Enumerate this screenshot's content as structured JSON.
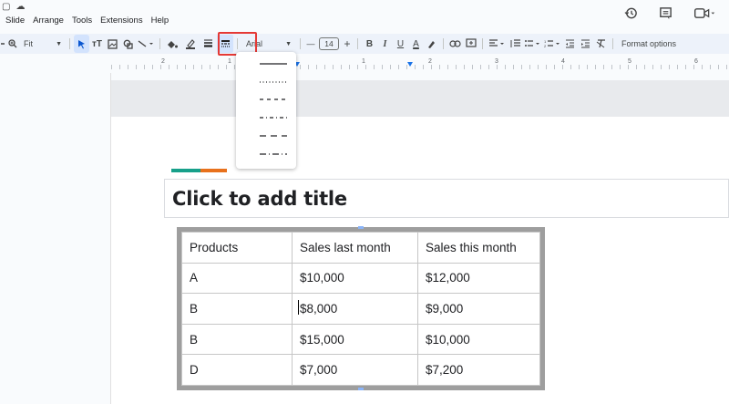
{
  "menu": [
    "Slide",
    "Arrange",
    "Tools",
    "Extensions",
    "Help"
  ],
  "toolbar": {
    "zoom": "Fit",
    "font": "Arial",
    "font_size": "14",
    "format_options": "Format options"
  },
  "ruler_numbers": [
    "2",
    "1",
    "1",
    "2",
    "3",
    "4",
    "5",
    "6"
  ],
  "dropdown": {
    "options": [
      "solid",
      "dotted",
      "dashed",
      "dash-dot",
      "long-dash",
      "long-dash-dot"
    ]
  },
  "slide": {
    "title_placeholder": "Click to add title",
    "accent_colors": [
      "#17a08a",
      "#e8711c"
    ]
  },
  "table": {
    "headers": [
      "Products",
      "Sales last month",
      "Sales this month"
    ],
    "rows": [
      [
        "A",
        "$10,000",
        "$12,000"
      ],
      [
        "B",
        "$8,000",
        "$9,000"
      ],
      [
        "B",
        "$15,000",
        "$10,000"
      ],
      [
        "D",
        "$7,000",
        "$7,200"
      ]
    ]
  }
}
